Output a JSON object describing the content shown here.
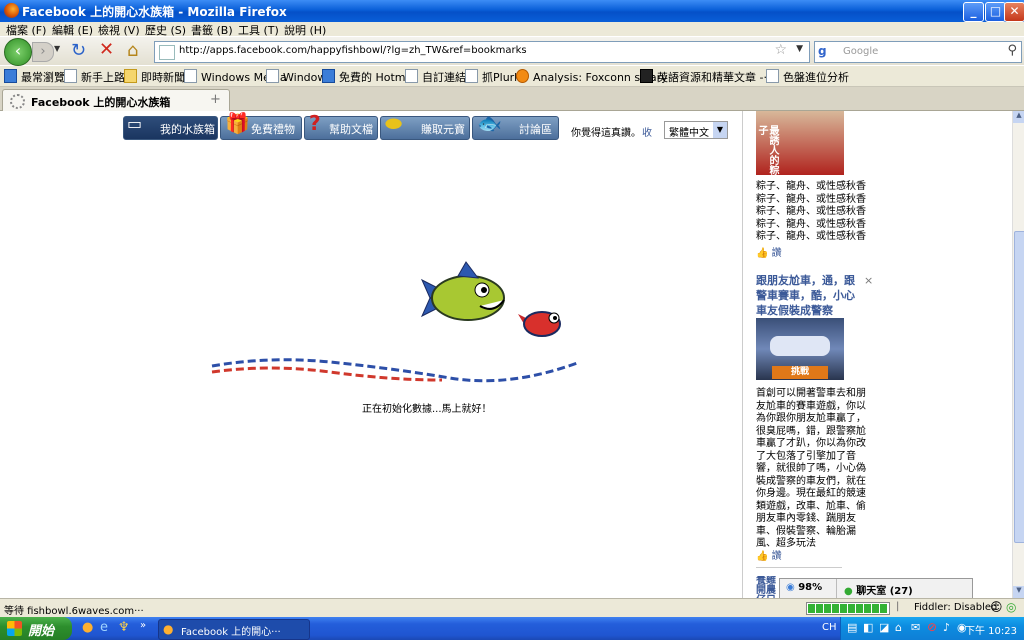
{
  "window": {
    "title": "Facebook 上的開心水族箱 - Mozilla Firefox",
    "controls": {
      "minimize": "_",
      "maximize": "□",
      "close": "✕"
    }
  },
  "menu": [
    "檔案 (F)",
    "編輯 (E)",
    "檢視 (V)",
    "歷史 (S)",
    "書籤 (B)",
    "工具 (T)",
    "說明 (H)"
  ],
  "nav": {
    "url": "http://apps.facebook.com/happyfishbowl/?lg=zh_TW&ref=bookmarks",
    "search_placeholder": "Google"
  },
  "bookmarks": [
    "最常瀏覽",
    "新手上路",
    "即時新聞",
    "Windows Media",
    "Windows",
    "免費的 Hotmail",
    "自訂連結",
    "抓Plurk",
    "Analysis: Foxconn salary···",
    "英語資源和精華文章 -···",
    "色盤進位分析"
  ],
  "tab": {
    "label": "Facebook 上的開心水族箱"
  },
  "game": {
    "buttons": [
      "我的水族箱",
      "免費禮物",
      "幫助文檔",
      "賺取元寶",
      "討論區"
    ],
    "feedback": "你覺得這真讚。",
    "collapse": "收",
    "language": "繁體中文",
    "loading": "正在初始化數據...馬上就好！"
  },
  "ads": {
    "ad1_image_text": "最誘人的粽子",
    "ad1_lines": [
      "粽子、龍舟、或性感秋香",
      "粽子、龍舟、或性感秋香",
      "粽子、龍舟、或性感秋香",
      "粽子、龍舟、或性感秋香",
      "粽子、龍舟、或性感秋香"
    ],
    "like": "讚",
    "ad2_title": "跟朋友尬車，通，跟警車賽車，酷，小心車友假裝成警察",
    "ad2_close": "×",
    "ad2_image_btn": "挑戰",
    "ad2_lines": [
      "首創可以開著警車去和朋",
      "友尬車的賽車遊戲，你以",
      "為你跟你朋友尬車贏了，",
      "很臭屁嗎，錯，跟警察尬",
      "車贏了才趴，你以為你改",
      "了大包落了引擎加了音",
      "響，就很帥了嗎，小心偽",
      "裝成警察的車友們，就在",
      "你身邊。現在最紅的競速",
      "類遊戲，改車、尬車、偷",
      "朋友車內零錢、踹朋友",
      "車、假裝警察、輪胎漏",
      "風、超多玩法"
    ],
    "ad3_partial": "養雞開農 仔只送"
  },
  "chat": {
    "percent": "98%",
    "label": "聊天室 (27)"
  },
  "status": {
    "text": "等待 fishbowl.6waves.com···",
    "fiddler": "Fiddler: Disabled",
    "progress": 1.0
  },
  "taskbar": {
    "start": "開始",
    "item": "Facebook 上的開心···",
    "ime": "CH",
    "clock": "下午 10:23"
  }
}
